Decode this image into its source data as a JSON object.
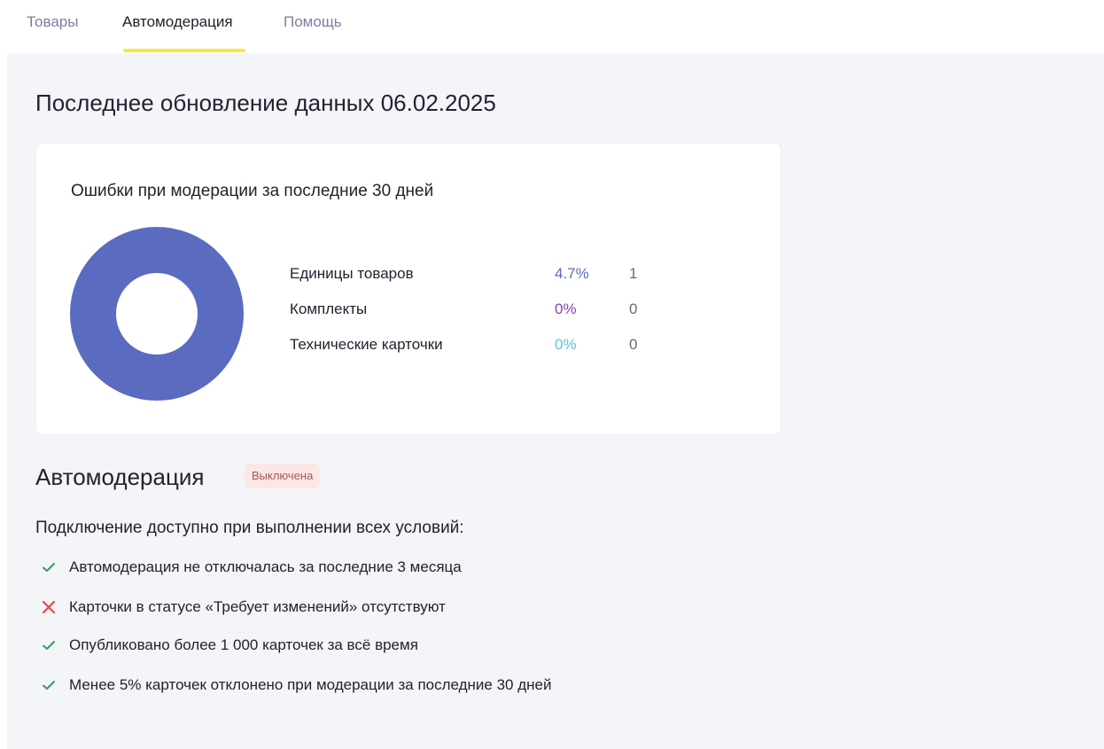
{
  "tabs": [
    {
      "label": "Товары",
      "active": false
    },
    {
      "label": "Автомодерация",
      "active": true
    },
    {
      "label": "Помощь",
      "active": false
    }
  ],
  "update": {
    "title": "Последнее обновление данных 06.02.2025"
  },
  "errors_card": {
    "title": "Ошибки при модерации за последние 30 дней",
    "items": [
      {
        "label": "Единицы товаров",
        "percent": "4.7%",
        "count": "1",
        "color": "#5b6bbf"
      },
      {
        "label": "Комплекты",
        "percent": "0%",
        "count": "0",
        "color": "#8b3fa8"
      },
      {
        "label": "Технические карточки",
        "percent": "0%",
        "count": "0",
        "color": "#5cc4d6"
      }
    ],
    "donut_color": "#5b6bbf"
  },
  "automoderation": {
    "title": "Автомодерация",
    "status_badge": "Выключена",
    "conditions_title": "Подключение доступно при выполнении всех условий:",
    "conditions": [
      {
        "text": "Автомодерация не отключалась за последние 3 месяца",
        "status": "ok",
        "icon": "check-icon"
      },
      {
        "text": "Карточки в статусе «Требует изменений» отсутствуют",
        "status": "fail",
        "icon": "cross-icon"
      },
      {
        "text": "Опубликовано более 1 000 карточек за всё время",
        "status": "ok",
        "icon": "check-icon"
      },
      {
        "text": "Менее 5% карточек отклонено при модерации за последние 30 дней",
        "status": "ok",
        "icon": "check-icon"
      }
    ]
  },
  "colors": {
    "ok": "#2f9e5a",
    "fail": "#e5484d",
    "tab_underline": "#f5ea3c"
  }
}
